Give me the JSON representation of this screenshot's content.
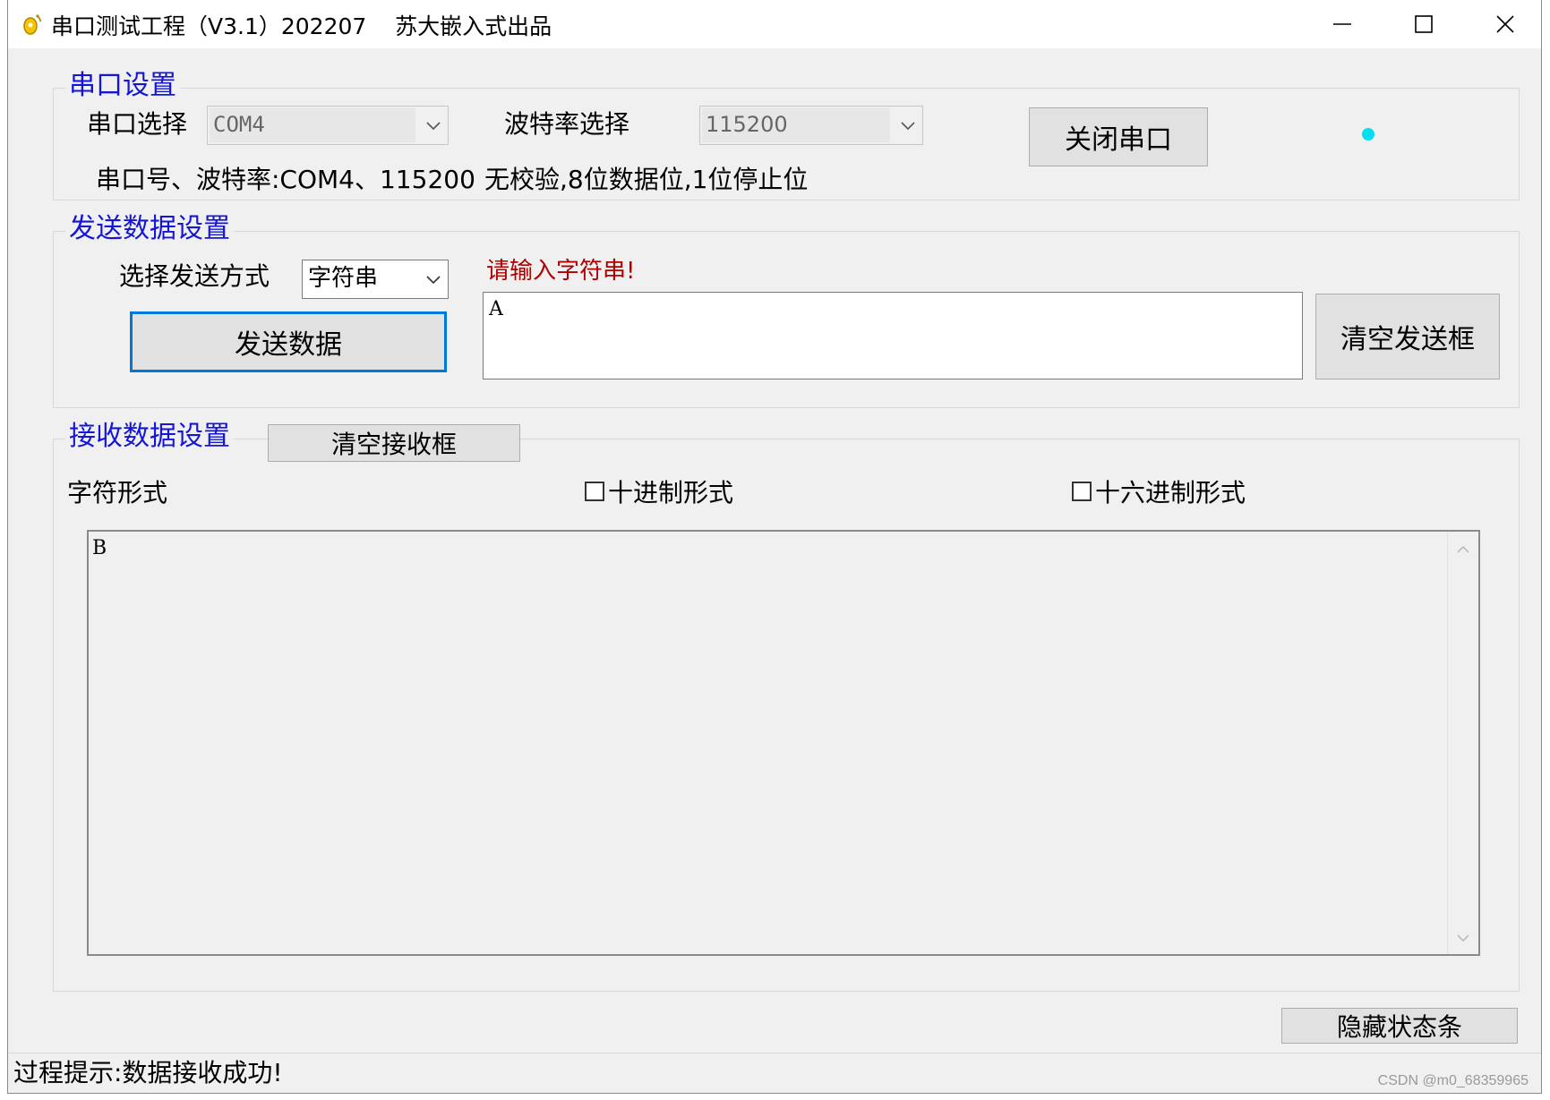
{
  "window": {
    "title": "串口测试工程（V3.1）202207    苏大嵌入式出品"
  },
  "serial_settings": {
    "group_title": "串口设置",
    "port_label": "串口选择",
    "port_value": "COM4",
    "baud_label": "波特率选择",
    "baud_value": "115200",
    "close_button": "关闭串口",
    "info_port_baud": "串口号、波特率:COM4、115200",
    "info_format": "无校验,8位数据位,1位停止位",
    "led_color": "#00e0f0"
  },
  "send_settings": {
    "group_title": "发送数据设置",
    "mode_label": "选择发送方式",
    "mode_value": "字符串",
    "send_button": "发送数据",
    "prompt": "请输入字符串!",
    "input_value": "A",
    "clear_button": "清空发送框"
  },
  "receive_settings": {
    "group_title": "接收数据设置",
    "clear_button": "清空接收框",
    "char_format_label": "字符形式",
    "decimal_label": "十进制形式",
    "hex_label": "十六进制形式",
    "received_text": "B"
  },
  "hide_status_button": "隐藏状态条",
  "status_bar": {
    "text": "过程提示:数据接收成功!"
  },
  "watermark": "CSDN @m0_68359965"
}
